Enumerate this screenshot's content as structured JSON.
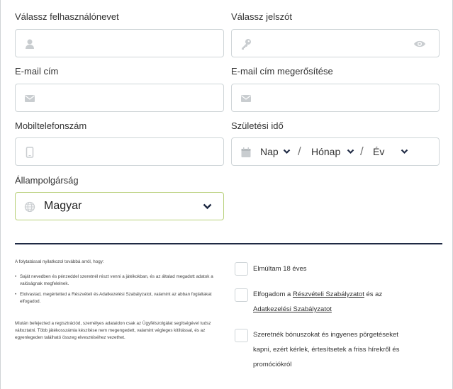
{
  "labels": {
    "username": "Válassz felhasználónevet",
    "password": "Válassz jelszót",
    "email": "E-mail cím",
    "email_confirm": "E-mail cím megerősítése",
    "mobile": "Mobiltelefonszám",
    "birth": "Születési idő",
    "nationality": "Állampolgárság"
  },
  "fields": {
    "username": {
      "value": "",
      "icon": "user-icon"
    },
    "password": {
      "value": "",
      "icon": "key-icon",
      "toggle_icon": "eye-icon"
    },
    "email": {
      "value": "",
      "icon": "envelope-icon"
    },
    "email_confirm": {
      "value": "",
      "icon": "envelope-icon"
    },
    "mobile": {
      "value": "",
      "icon": "phone-icon"
    },
    "birth": {
      "icon": "calendar-icon",
      "day": "Nap",
      "month": "Hónap",
      "year": "Év",
      "separator": "/"
    },
    "nationality": {
      "icon": "globe-icon",
      "value": "Magyar",
      "border_color": "#b8d07a"
    }
  },
  "legal": {
    "intro": "A folytatással nyilatkozol továbbá arról, hogy:",
    "bullets": [
      "Saját nevedben és pénzeddel szeretnél részt venni a játékokban, és az általad megadott adatok a valóságnak megfelelnek.",
      "Elolvastad, megértetted a Részvételi és Adatkezelési Szabályzatot, valamint az abban foglaltakat elfogadod."
    ],
    "footer": "Miután befejezted a regisztrációd, személyes adataidon csak az Ügyfélszolgálat segítségével tudsz változtatni. Több játékosszámla készítése nem megengedett, valamint végleges kitiltással, és az egyenlegeden található összeg elvesztéséhez vezethet."
  },
  "checkboxes": {
    "age": {
      "label": "Elmúltam 18 éves",
      "checked": false
    },
    "terms": {
      "prefix": "Elfogadom a ",
      "link1": "Részvételi Szabályzatot",
      "middle": " és az",
      "link2": "Adatkezelési Szabályzatot",
      "checked": false
    },
    "bonus": {
      "line1": "Szeretnék bónuszokat és ingyenes pörgetéseket",
      "line2": "kapni, ezért kérlek, értesítsetek a friss hírekről és",
      "line3": "promóciókról",
      "checked": false
    }
  },
  "colors": {
    "divider": "#1f2a44",
    "icon": "#c9cdd0",
    "nationality_border": "#b8d07a"
  }
}
